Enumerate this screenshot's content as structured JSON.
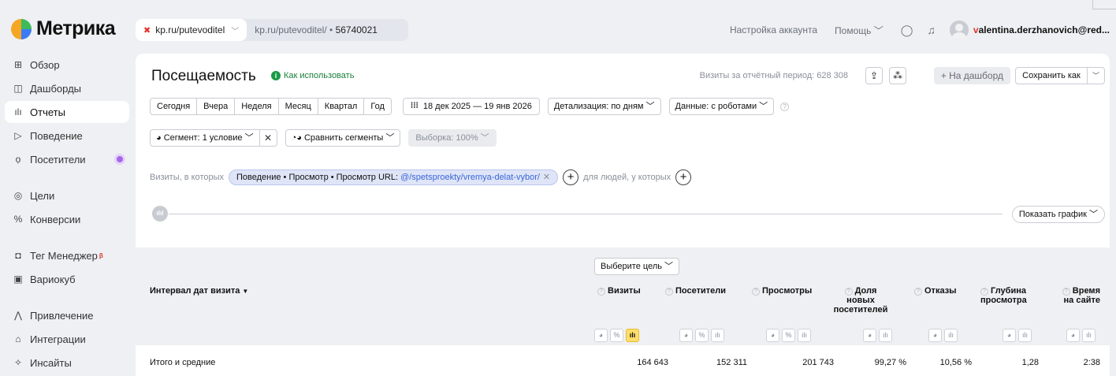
{
  "app": {
    "logo_text": "Метрика"
  },
  "counter": {
    "selected": "kp.ru/putevoditel",
    "path": "kp.ru/putevoditel/",
    "separator": "•",
    "id": "56740021"
  },
  "topbar": {
    "account_settings": "Настройка аккаунта",
    "help": "Помощь",
    "user_first": "v",
    "user_rest": "alentina.derzhanovich@red..."
  },
  "sidebar": {
    "items": [
      {
        "label": "Обзор",
        "icon": "grid-icon"
      },
      {
        "label": "Дашборды",
        "icon": "dashboard-icon"
      },
      {
        "label": "Отчеты",
        "icon": "reports-icon"
      },
      {
        "label": "Поведение",
        "icon": "play-icon"
      },
      {
        "label": "Посетители",
        "icon": "visitor-icon"
      },
      {
        "label": "Цели",
        "icon": "target-icon"
      },
      {
        "label": "Конверсии",
        "icon": "percent-icon"
      },
      {
        "label": "Тег Менеджер",
        "icon": "tag-icon",
        "badge": "β"
      },
      {
        "label": "Вариокуб",
        "icon": "cube-icon"
      },
      {
        "label": "Привлечение",
        "icon": "attraction-icon"
      },
      {
        "label": "Интеграции",
        "icon": "integration-icon"
      },
      {
        "label": "Инсайты",
        "icon": "sparkle-icon"
      }
    ],
    "active": "Отчеты"
  },
  "report": {
    "title": "Посещаемость",
    "how_to_use": "Как использовать",
    "visits_total": "Визиты за отчётный период: 628 308",
    "add_dashboard": "+ На дашборд",
    "save_as": "Сохранить как"
  },
  "period": {
    "buttons": [
      "Сегодня",
      "Вчера",
      "Неделя",
      "Месяц",
      "Квартал",
      "Год"
    ],
    "date_range": "18 дек 2025 — 19 янв 2026",
    "detail": "Детализация: по дням",
    "data": "Данные: с роботами"
  },
  "segment": {
    "label": "Сегмент: 1 условие",
    "compare": "Сравнить сегменты",
    "sample": "Выборка: 100%"
  },
  "filter": {
    "prefix": "Визиты, в которых",
    "chip_label": "Поведение • Просмотр • Просмотр URL: ",
    "chip_url": "@/spetsproekty/vremya-delat-vybor/",
    "people": "для людей, у которых"
  },
  "graph": {
    "show_graph": "Показать график"
  },
  "table": {
    "choose_goal": "Выберите цель",
    "dimension": "Интервал дат визита",
    "sort_marker": "▼",
    "columns": [
      {
        "line1": "Визиты",
        "line2": "",
        "line3": ""
      },
      {
        "line1": "Посетители",
        "line2": "",
        "line3": ""
      },
      {
        "line1": "Просмотры",
        "line2": "",
        "line3": ""
      },
      {
        "line1": "Доля",
        "line2": "новых",
        "line3": "посетителей"
      },
      {
        "line1": "Отказы",
        "line2": "",
        "line3": ""
      },
      {
        "line1": "Глубина",
        "line2": "просмотра",
        "line3": ""
      },
      {
        "line1": "Время",
        "line2": "на сайте",
        "line3": ""
      }
    ],
    "totals_label": "Итого и средние",
    "totals": [
      "164 643",
      "152 311",
      "201 743",
      "99,27 %",
      "10,56 %",
      "1,28",
      "2:38"
    ]
  },
  "colors": {
    "accent_yellow": "#ffdd6b",
    "chip_blue": "#dfe5f7",
    "link_green": "#1a7f3a",
    "brand_red": "#e0352b"
  }
}
